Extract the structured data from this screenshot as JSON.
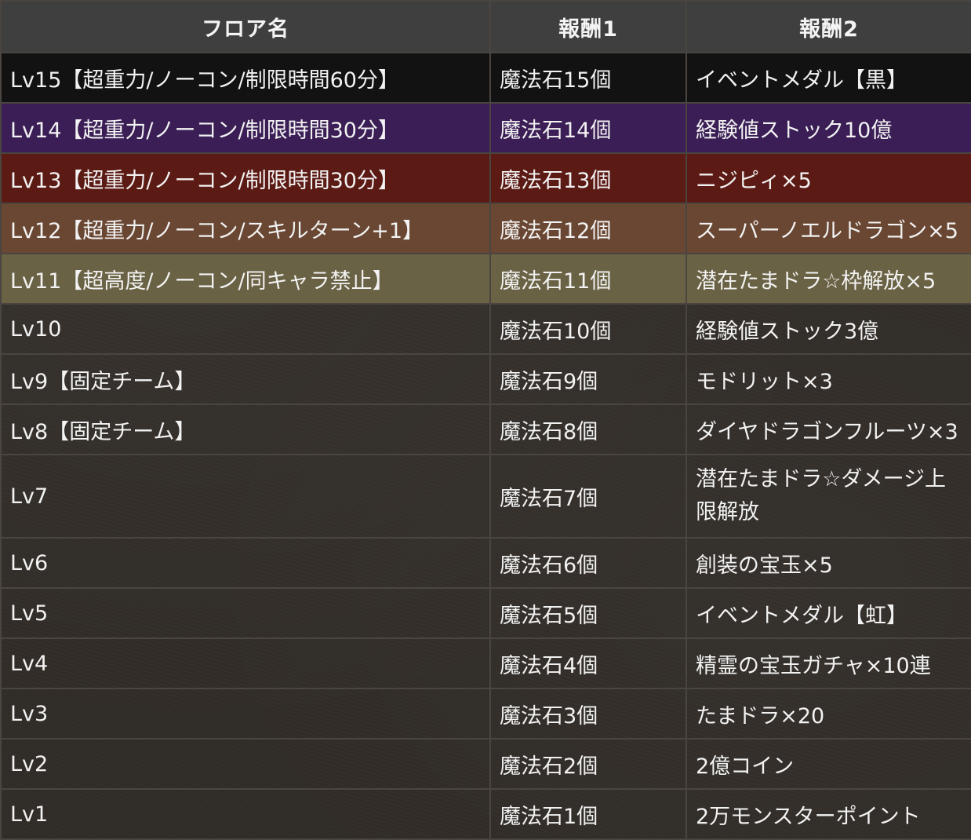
{
  "headers": [
    "フロア名",
    "報酬1",
    "報酬2"
  ],
  "row_colors": {
    "black": "#121212",
    "purple": "#3a1e55",
    "red": "#5c1a14",
    "brown": "#6a4733",
    "olive": "#6a6244",
    "default": "transparent"
  },
  "rows": [
    {
      "floor": "Lv15【超重力/ノーコン/制限時間60分】",
      "reward1": "魔法石15個",
      "reward2": "イベントメダル【黒】",
      "color": "black"
    },
    {
      "floor": "Lv14【超重力/ノーコン/制限時間30分】",
      "reward1": "魔法石14個",
      "reward2": "経験値ストック10億",
      "color": "purple"
    },
    {
      "floor": "Lv13【超重力/ノーコン/制限時間30分】",
      "reward1": "魔法石13個",
      "reward2": "ニジピィ×5",
      "color": "red"
    },
    {
      "floor": "Lv12【超重力/ノーコン/スキルターン+1】",
      "reward1": "魔法石12個",
      "reward2": "スーパーノエルドラゴン×5",
      "color": "brown"
    },
    {
      "floor": "Lv11【超高度/ノーコン/同キャラ禁止】",
      "reward1": "魔法石11個",
      "reward2": "潜在たまドラ☆枠解放×5",
      "color": "olive"
    },
    {
      "floor": "Lv10",
      "reward1": "魔法石10個",
      "reward2": "経験値ストック3億",
      "color": "default"
    },
    {
      "floor": "Lv9【固定チーム】",
      "reward1": "魔法石9個",
      "reward2": "モドリット×3",
      "color": "default"
    },
    {
      "floor": "Lv8【固定チーム】",
      "reward1": "魔法石8個",
      "reward2": "ダイヤドラゴンフルーツ×3",
      "color": "default"
    },
    {
      "floor": "Lv7",
      "reward1": "魔法石7個",
      "reward2": "潜在たまドラ☆ダメージ上限解放",
      "color": "default",
      "tall": true
    },
    {
      "floor": "Lv6",
      "reward1": "魔法石6個",
      "reward2": "創装の宝玉×5",
      "color": "default"
    },
    {
      "floor": "Lv5",
      "reward1": "魔法石5個",
      "reward2": "イベントメダル【虹】",
      "color": "default"
    },
    {
      "floor": "Lv4",
      "reward1": "魔法石4個",
      "reward2": "精霊の宝玉ガチャ×10連",
      "color": "default"
    },
    {
      "floor": "Lv3",
      "reward1": "魔法石3個",
      "reward2": "たまドラ×20",
      "color": "default"
    },
    {
      "floor": "Lv2",
      "reward1": "魔法石2個",
      "reward2": "2億コイン",
      "color": "default"
    },
    {
      "floor": "Lv1",
      "reward1": "魔法石1個",
      "reward2": "2万モンスターポイント",
      "color": "default"
    }
  ]
}
